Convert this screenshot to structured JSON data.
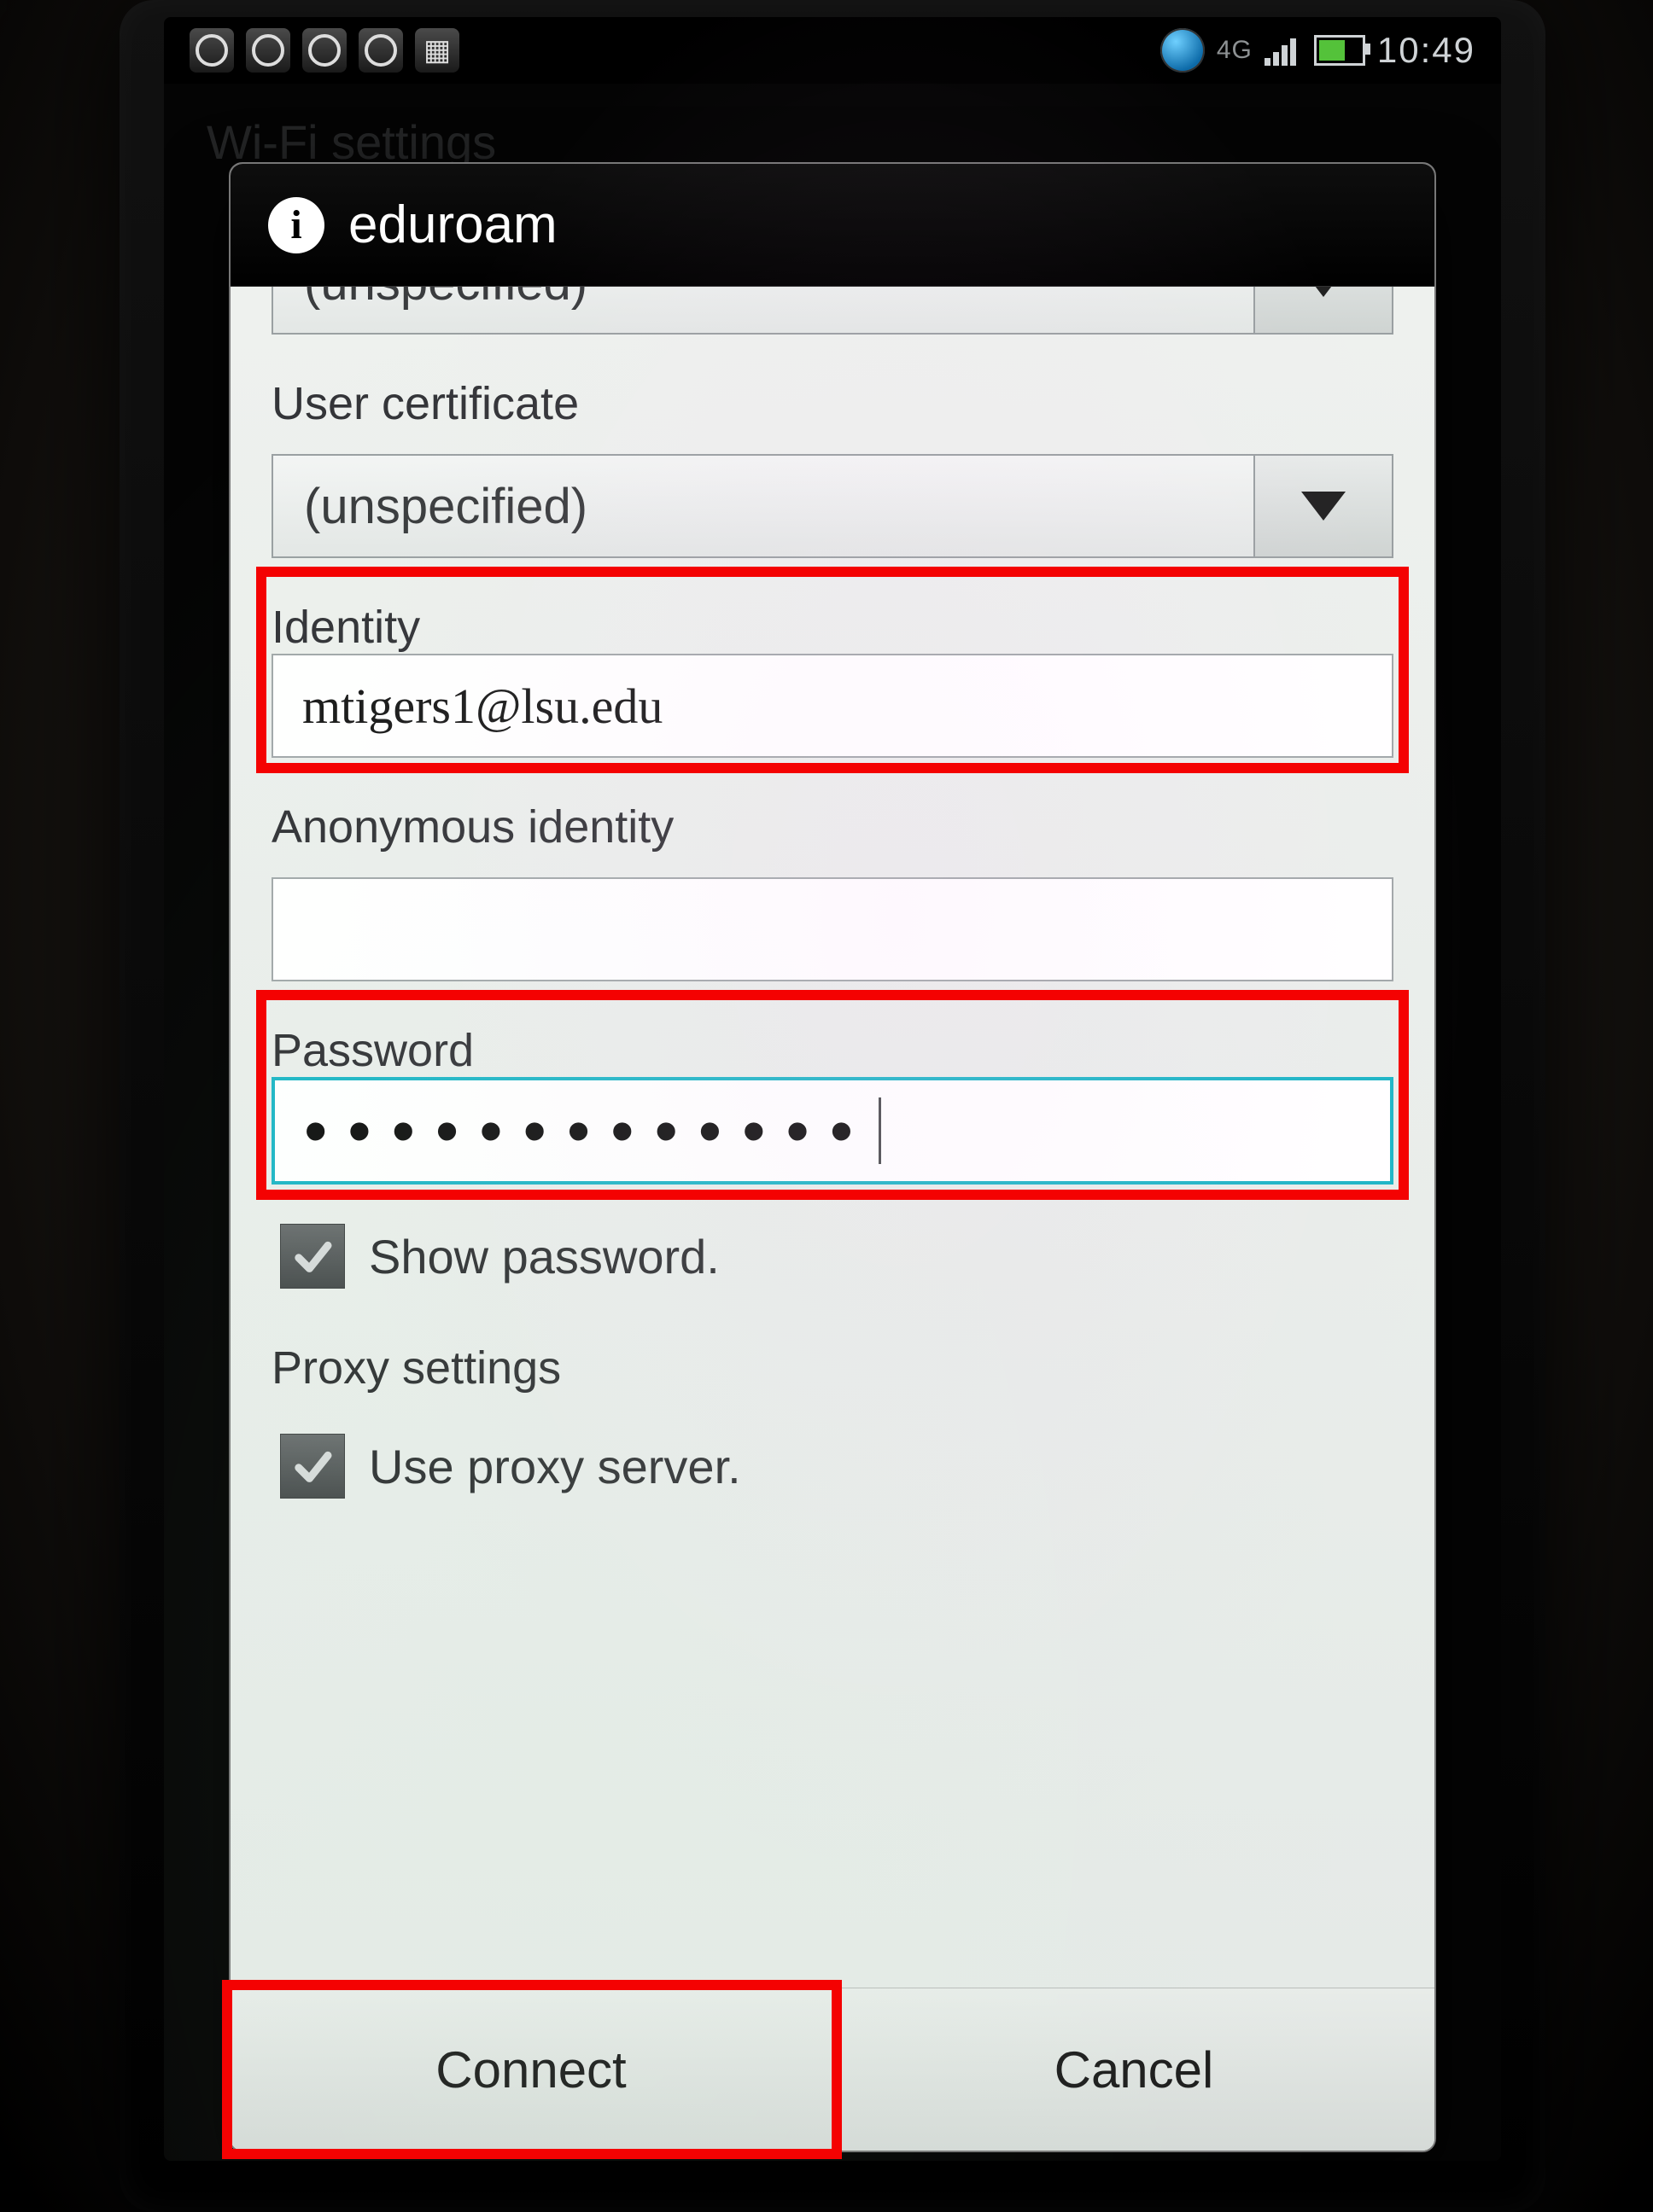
{
  "statusbar": {
    "network_badge": "4G",
    "time": "10:49"
  },
  "background_page": {
    "title": "Wi-Fi settings"
  },
  "dialog": {
    "title": "eduroam",
    "ca_certificate": {
      "value": "(unspecified)"
    },
    "user_certificate": {
      "label": "User certificate",
      "value": "(unspecified)"
    },
    "identity": {
      "label": "Identity",
      "value": "mtigers1@lsu.edu"
    },
    "anonymous_identity": {
      "label": "Anonymous identity",
      "value": ""
    },
    "password": {
      "label": "Password",
      "masked": "•••••••••••••"
    },
    "show_password": {
      "label": "Show password.",
      "checked": false
    },
    "proxy_section": {
      "label": "Proxy settings"
    },
    "use_proxy": {
      "label": "Use proxy server.",
      "checked": false
    },
    "buttons": {
      "connect": "Connect",
      "cancel": "Cancel"
    }
  }
}
